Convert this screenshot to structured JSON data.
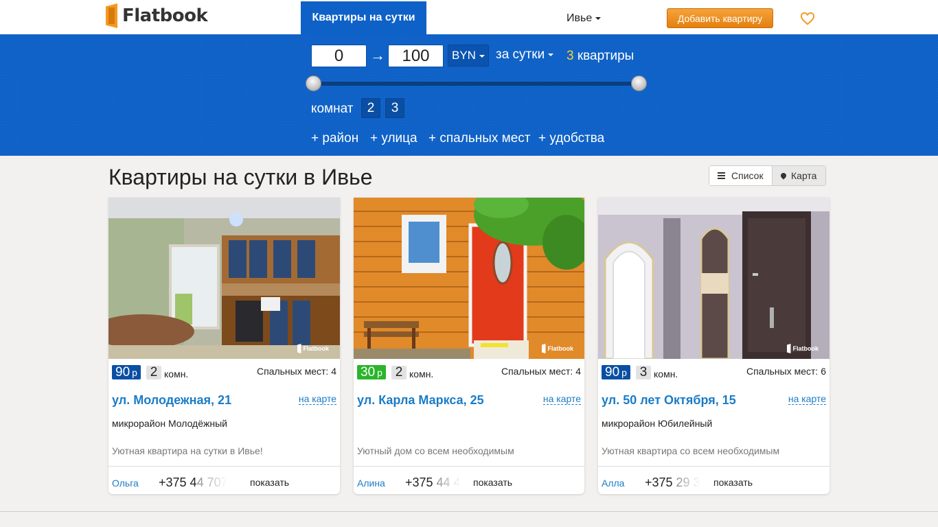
{
  "header": {
    "logo_text": "Flatbook",
    "nav_tab": "Квартиры на сутки",
    "city": "Ивье",
    "add_button": "Добавить квартиру",
    "brand_color": "#0e61c7",
    "accent_color": "#f39a1f"
  },
  "filter": {
    "price_min": "0",
    "arrow": "→",
    "price_max": "100",
    "currency": "BYN",
    "period": "за сутки",
    "result_count": "3",
    "result_label": "квартиры",
    "slider": {
      "min_value": 0,
      "max_value": 100
    },
    "rooms_label": "комнат",
    "rooms": [
      "2",
      "3"
    ],
    "extras": [
      "+ район",
      "+ улица",
      "+ спальных мест",
      "+ удобства"
    ]
  },
  "content": {
    "page_title": "Квартиры на сутки в Ивье",
    "view_list": "Список",
    "view_map": "Карта"
  },
  "listings": [
    {
      "price": "90",
      "currency": "р",
      "price_color": "#0a4fa3",
      "rooms": "2",
      "rooms_unit": "комн.",
      "beds": "Спальных мест: 4",
      "address": "ул. Молодежная, 21",
      "map_link": "на карте",
      "district": "микрорайон Молодёжный",
      "description": "Уютная квартира на сутки в Ивье!",
      "owner": "Ольга",
      "phone_visible": "+375 4",
      "phone_faded": "4 707",
      "show": "показать",
      "watermark": "Flatbook"
    },
    {
      "price": "30",
      "currency": "р",
      "price_color": "#2ab52a",
      "rooms": "2",
      "rooms_unit": "комн.",
      "beds": "Спальных мест: 4",
      "address": "ул. Карла Маркса, 25",
      "map_link": "на карте",
      "district": "",
      "description": "Уютный дом со всем необходимым",
      "owner": "Алина",
      "phone_visible": "+375 ",
      "phone_faded": "44 4",
      "show": "показать",
      "watermark": "Flatbook"
    },
    {
      "price": "90",
      "currency": "р",
      "price_color": "#0a4fa3",
      "rooms": "3",
      "rooms_unit": "комн.",
      "beds": "Спальных мест: 6",
      "address": "ул. 50 лет Октября, 15",
      "map_link": "на карте",
      "district": "микрорайон Юбилейный",
      "description": "Уютная квартира со всем необходимым",
      "owner": "Алла",
      "phone_visible": "+375 ",
      "phone_faded": "29 3",
      "show": "показать",
      "watermark": "Flatbook"
    }
  ]
}
